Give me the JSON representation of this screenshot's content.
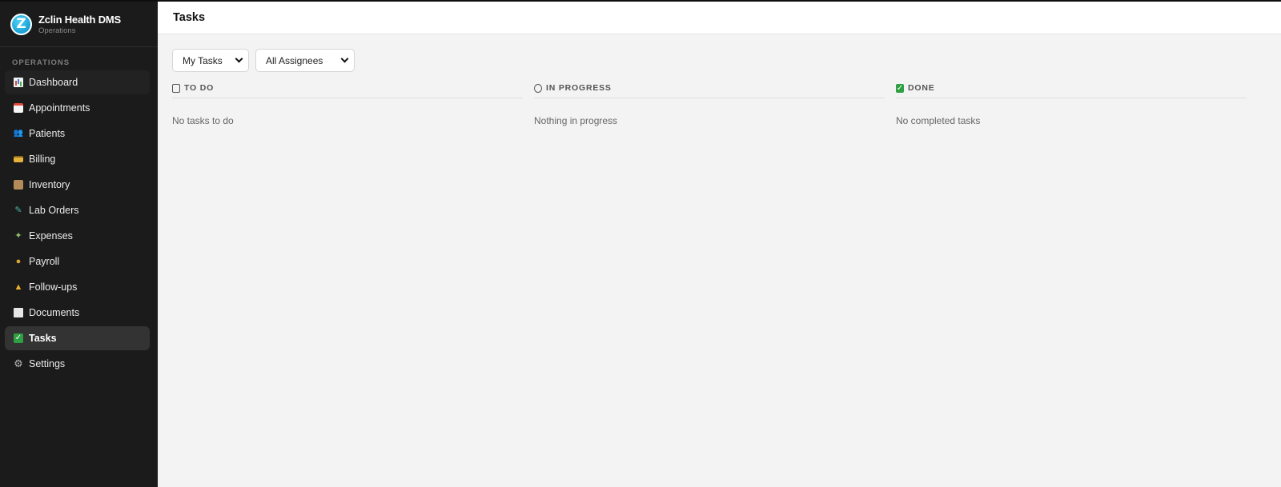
{
  "app": {
    "name": "Zclin Health DMS",
    "subtitle": "Operations",
    "logo_letter": "Z"
  },
  "sidebar": {
    "section_label": "OPERATIONS",
    "items": [
      {
        "label": "Dashboard",
        "icon": "chart-icon"
      },
      {
        "label": "Appointments",
        "icon": "calendar-icon"
      },
      {
        "label": "Patients",
        "icon": "patients-icon"
      },
      {
        "label": "Billing",
        "icon": "credit-card-icon"
      },
      {
        "label": "Inventory",
        "icon": "box-icon"
      },
      {
        "label": "Lab Orders",
        "icon": "test-tube-icon"
      },
      {
        "label": "Expenses",
        "icon": "money-icon"
      },
      {
        "label": "Payroll",
        "icon": "money-bag-icon"
      },
      {
        "label": "Follow-ups",
        "icon": "bell-icon"
      },
      {
        "label": "Documents",
        "icon": "document-icon"
      },
      {
        "label": "Tasks",
        "icon": "checkmark-icon",
        "active": true
      },
      {
        "label": "Settings",
        "icon": "gear-icon"
      }
    ]
  },
  "header": {
    "title": "Tasks"
  },
  "filters": {
    "scope": {
      "selected": "My Tasks"
    },
    "assignee": {
      "selected": "All Assignees"
    }
  },
  "columns": [
    {
      "title": "TO DO",
      "icon": "clipboard-icon",
      "empty_text": "No tasks to do"
    },
    {
      "title": "IN PROGRESS",
      "icon": "progress-icon",
      "empty_text": "Nothing in progress"
    },
    {
      "title": "DONE",
      "icon": "checkmark-icon",
      "empty_text": "No completed tasks"
    }
  ],
  "colors": {
    "sidebar_bg": "#1b1b1b",
    "active_item_bg": "#333333",
    "main_bg": "#f3f3f3",
    "accent_green": "#2ea043",
    "logo_blue": "#1aa3d6"
  }
}
